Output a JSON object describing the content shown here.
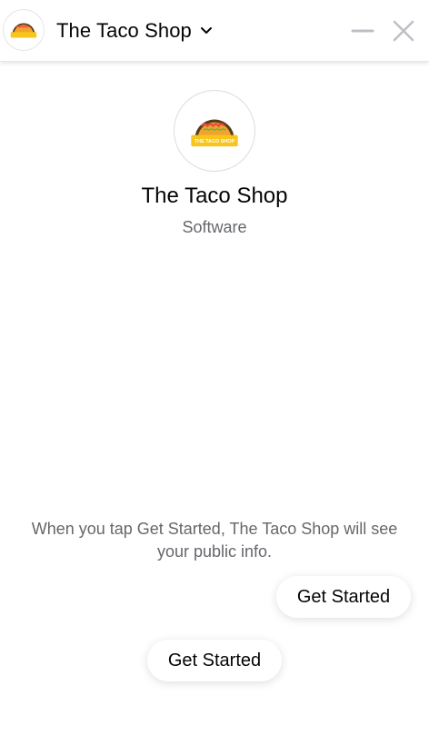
{
  "header": {
    "title": "The Taco Shop"
  },
  "logo": {
    "banner_text": "THE TACO SHOP",
    "banner_color": "#f7c51b",
    "shell_color": "#f0a32e",
    "filling_color": "#5a3b1e"
  },
  "profile": {
    "name": "The Taco Shop",
    "category": "Software"
  },
  "info": {
    "text": "When you tap Get Started, The Taco Shop will see your public info."
  },
  "buttons": {
    "get_started_reply": "Get Started",
    "get_started_primary": "Get Started"
  },
  "colors": {
    "text_primary": "#050505",
    "text_secondary": "#65676b",
    "control_gray": "#bcc0c4"
  }
}
